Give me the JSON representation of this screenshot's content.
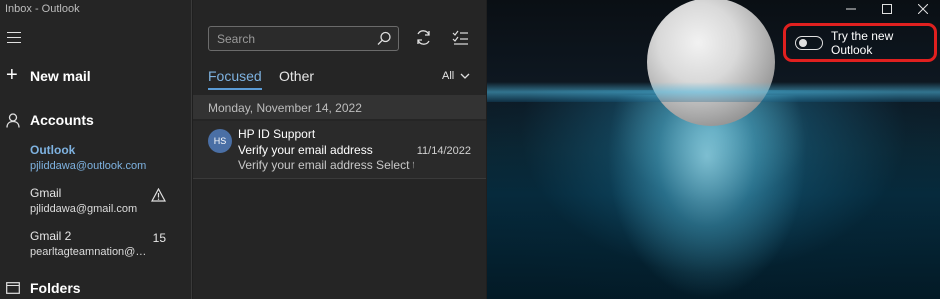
{
  "window": {
    "title": "Inbox - Outlook"
  },
  "nav": {
    "new_mail_label": "New mail",
    "accounts_label": "Accounts",
    "folders_label": "Folders",
    "accounts": [
      {
        "name": "Outlook",
        "email": "pjliddawa@outlook.com",
        "active": true
      },
      {
        "name": "Gmail",
        "email": "pjliddawa@gmail.com",
        "icon": "warning-icon"
      },
      {
        "name": "Gmail 2",
        "email": "pearltagteamnation@gm...",
        "count": "15"
      }
    ]
  },
  "list": {
    "search_placeholder": "Search",
    "tabs": {
      "focused": "Focused",
      "other": "Other"
    },
    "filter_label": "All",
    "date_header": "Monday, November 14, 2022",
    "messages": [
      {
        "initials": "HS",
        "sender": "HP ID Support",
        "subject": "Verify your email address",
        "date": "11/14/2022",
        "preview": "Verify your email address Select the"
      }
    ]
  },
  "reading": {
    "toggle_label": "Try the new Outlook",
    "toggle_on": false
  },
  "colors": {
    "accent": "#7eb2e0",
    "highlight_border": "#e0201f",
    "avatar": "#4a6fa5"
  }
}
